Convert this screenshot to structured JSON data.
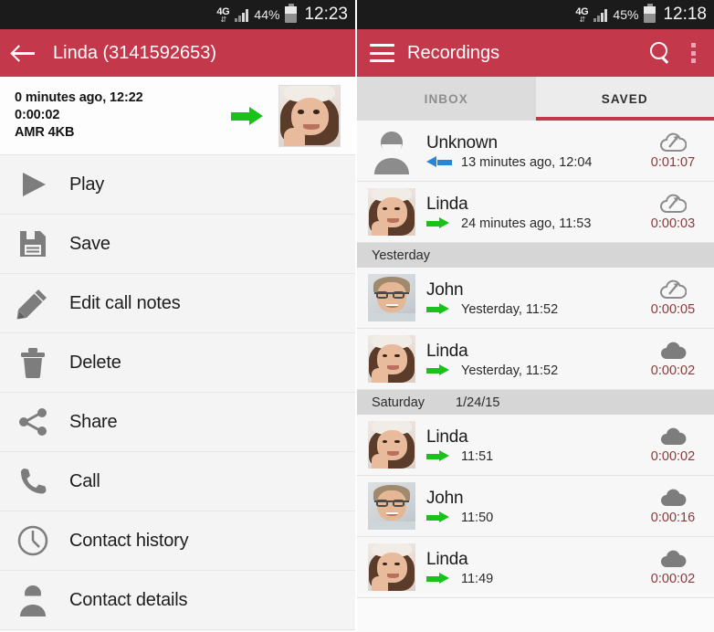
{
  "left": {
    "statusbar": {
      "network": "4G",
      "battery_percent": "44%",
      "time": "12:23"
    },
    "appbar": {
      "back_icon": "arrow-left-icon",
      "title": "Linda (3141592653)"
    },
    "detail": {
      "timestamp": "0 minutes ago, 12:22",
      "duration": "0:00:02",
      "format": "AMR 4KB",
      "direction": "outgoing",
      "direction_icon": "arrow-right-green-icon",
      "thumbnail": "linda-photo"
    },
    "menu": [
      {
        "label": "Play",
        "icon": "play-icon"
      },
      {
        "label": "Save",
        "icon": "floppy-save-icon"
      },
      {
        "label": "Edit call notes",
        "icon": "pencil-icon"
      },
      {
        "label": "Delete",
        "icon": "trash-icon"
      },
      {
        "label": "Share",
        "icon": "share-icon"
      },
      {
        "label": "Call",
        "icon": "phone-icon"
      },
      {
        "label": "Contact history",
        "icon": "clock-icon"
      },
      {
        "label": "Contact details",
        "icon": "person-icon"
      }
    ]
  },
  "right": {
    "statusbar": {
      "network": "4G",
      "battery_percent": "45%",
      "time": "12:18"
    },
    "appbar": {
      "menu_icon": "hamburger-icon",
      "title": "Recordings",
      "search_icon": "search-icon",
      "overflow_icon": "overflow-menu-icon"
    },
    "tabs": [
      {
        "label": "INBOX",
        "active": false
      },
      {
        "label": "SAVED",
        "active": true
      }
    ],
    "sections": [
      {
        "header": null,
        "header_date": null,
        "rows": [
          {
            "name": "Unknown",
            "when": "13 minutes ago, 12:04",
            "duration": "0:01:07",
            "direction": "incoming",
            "cloud": "cloud-off",
            "avatar": "unknown"
          },
          {
            "name": "Linda",
            "when": "24 minutes ago, 11:53",
            "duration": "0:00:03",
            "direction": "outgoing",
            "cloud": "cloud-off",
            "avatar": "linda"
          }
        ]
      },
      {
        "header": "Yesterday",
        "header_date": "",
        "rows": [
          {
            "name": "John",
            "when": "Yesterday, 11:52",
            "duration": "0:00:05",
            "direction": "outgoing",
            "cloud": "cloud-off",
            "avatar": "john"
          },
          {
            "name": "Linda",
            "when": "Yesterday, 11:52",
            "duration": "0:00:02",
            "direction": "outgoing",
            "cloud": "cloud-synced",
            "avatar": "linda"
          }
        ]
      },
      {
        "header": "Saturday",
        "header_date": "1/24/15",
        "rows": [
          {
            "name": "Linda",
            "when": "11:51",
            "duration": "0:00:02",
            "direction": "outgoing",
            "cloud": "cloud-synced",
            "avatar": "linda"
          },
          {
            "name": "John",
            "when": "11:50",
            "duration": "0:00:16",
            "direction": "outgoing",
            "cloud": "cloud-synced",
            "avatar": "john"
          },
          {
            "name": "Linda",
            "when": "11:49",
            "duration": "0:00:02",
            "direction": "outgoing",
            "cloud": "cloud-synced",
            "avatar": "linda"
          }
        ]
      }
    ]
  },
  "colors": {
    "brand_red": "#c4384b",
    "status_bar": "#1b1b1b",
    "outgoing_green": "#18c21a",
    "incoming_blue": "#2b85d6",
    "duration_text": "#8a3a3a",
    "section_header_bg": "#d6d6d6"
  }
}
